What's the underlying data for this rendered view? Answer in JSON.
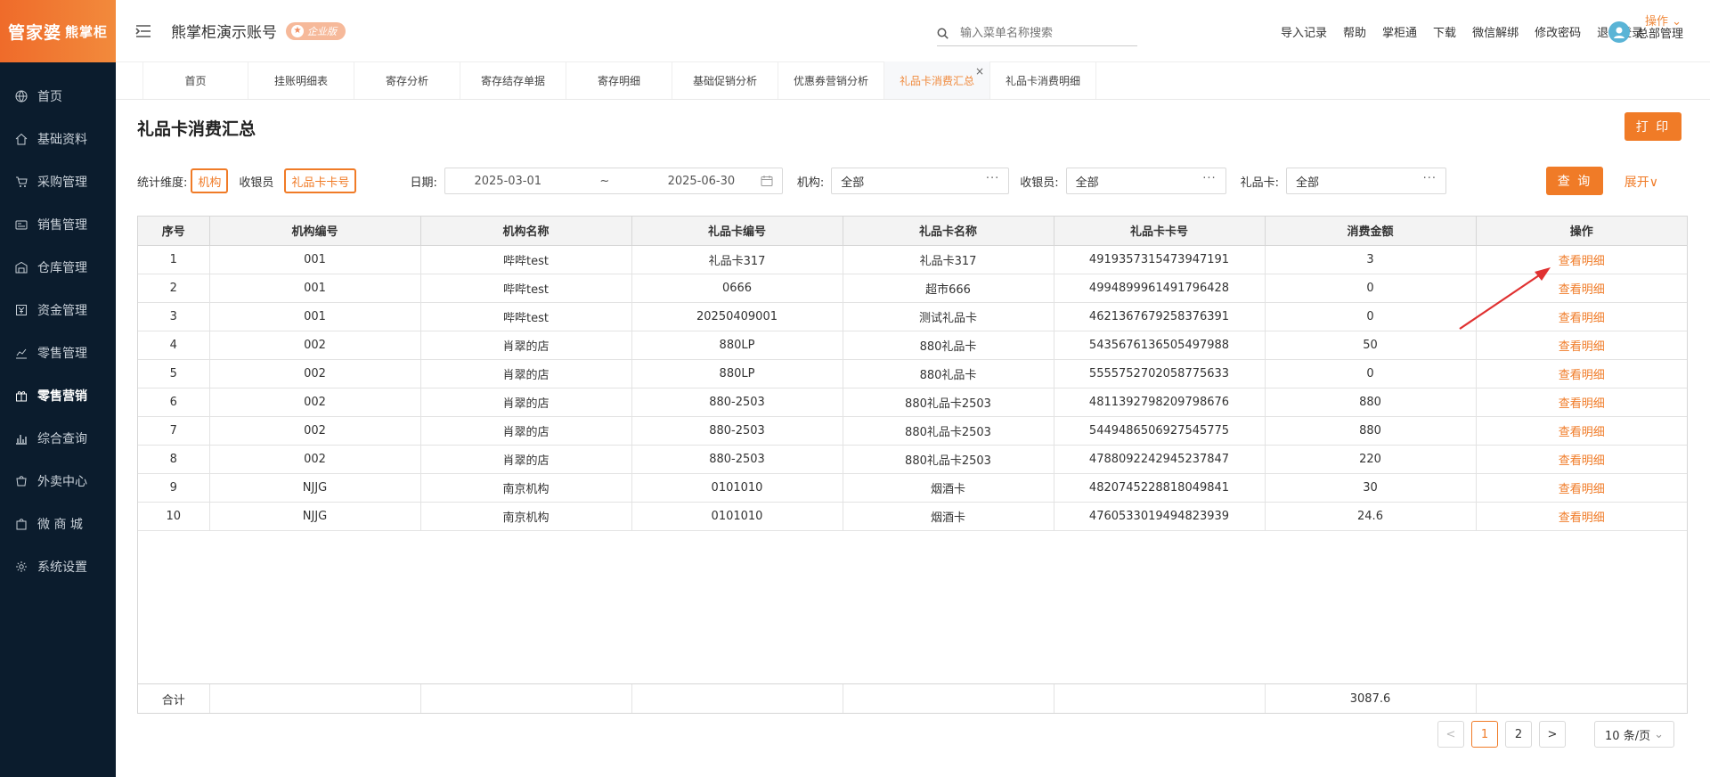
{
  "brand": {
    "main": "管家婆",
    "sub": "熊掌柜"
  },
  "sidebar": {
    "items": [
      {
        "label": "首页",
        "icon": "globe-icon"
      },
      {
        "label": "基础资料",
        "icon": "home-icon"
      },
      {
        "label": "采购管理",
        "icon": "cart-icon"
      },
      {
        "label": "销售管理",
        "icon": "register-icon"
      },
      {
        "label": "仓库管理",
        "icon": "warehouse-icon"
      },
      {
        "label": "资金管理",
        "icon": "finance-icon"
      },
      {
        "label": "零售管理",
        "icon": "chart-icon"
      },
      {
        "label": "零售营销",
        "icon": "gift-icon"
      },
      {
        "label": "综合查询",
        "icon": "bar-chart-icon"
      },
      {
        "label": "外卖中心",
        "icon": "delivery-icon"
      },
      {
        "label": "微 商 城",
        "icon": "shop-icon"
      },
      {
        "label": "系统设置",
        "icon": "gear-icon"
      }
    ]
  },
  "header": {
    "account_title": "熊掌柜演示账号",
    "edition": "企业版",
    "search_placeholder": "输入菜单名称搜索",
    "links": [
      "导入记录",
      "帮助",
      "掌柜通",
      "下载",
      "微信解绑",
      "修改密码",
      "退出登录"
    ],
    "user": "总部管理"
  },
  "tabs": [
    "首页",
    "挂账明细表",
    "寄存分析",
    "寄存结存单据",
    "寄存明细",
    "基础促销分析",
    "优惠券营销分析",
    "礼品卡消费汇总",
    "礼品卡消费明细"
  ],
  "tabs_ops": "操作",
  "page": {
    "title": "礼品卡消费汇总",
    "print": "打 印",
    "dim_label": "统计维度:",
    "dims": [
      "机构",
      "收银员",
      "礼品卡卡号"
    ],
    "date_label": "日期:",
    "date_from": "2025-03-01",
    "date_sep": "~",
    "date_to": "2025-06-30",
    "org_label": "机构:",
    "org_value": "全部",
    "cashier_label": "收银员:",
    "cashier_value": "全部",
    "card_label": "礼品卡:",
    "card_value": "全部",
    "query": "查 询",
    "expand": "展开"
  },
  "table": {
    "columns": [
      "序号",
      "机构编号",
      "机构名称",
      "礼品卡编号",
      "礼品卡名称",
      "礼品卡卡号",
      "消费金额",
      "操作"
    ],
    "rows": [
      [
        "1",
        "001",
        "哔哔test",
        "礼品卡317",
        "礼品卡317",
        "4919357315473947191",
        "3",
        "查看明细"
      ],
      [
        "2",
        "001",
        "哔哔test",
        "0666",
        "超市666",
        "4994899961491796428",
        "0",
        "查看明细"
      ],
      [
        "3",
        "001",
        "哔哔test",
        "20250409001",
        "测试礼品卡",
        "4621367679258376391",
        "0",
        "查看明细"
      ],
      [
        "4",
        "002",
        "肖翠的店",
        "880LP",
        "880礼品卡",
        "5435676136505497988",
        "50",
        "查看明细"
      ],
      [
        "5",
        "002",
        "肖翠的店",
        "880LP",
        "880礼品卡",
        "5555752702058775633",
        "0",
        "查看明细"
      ],
      [
        "6",
        "002",
        "肖翠的店",
        "880-2503",
        "880礼品卡2503",
        "4811392798209798676",
        "880",
        "查看明细"
      ],
      [
        "7",
        "002",
        "肖翠的店",
        "880-2503",
        "880礼品卡2503",
        "5449486506927545775",
        "880",
        "查看明细"
      ],
      [
        "8",
        "002",
        "肖翠的店",
        "880-2503",
        "880礼品卡2503",
        "4788092242945237847",
        "220",
        "查看明细"
      ],
      [
        "9",
        "NJJG",
        "南京机构",
        "0101010",
        "烟酒卡",
        "4820745228818049841",
        "30",
        "查看明细"
      ],
      [
        "10",
        "NJJG",
        "南京机构",
        "0101010",
        "烟酒卡",
        "4760533019494823939",
        "24.6",
        "查看明细"
      ]
    ],
    "footer_label": "合计",
    "footer_total": "3087.6"
  },
  "pager": {
    "prev": "<",
    "pages": [
      "1",
      "2"
    ],
    "current": "1",
    "next": ">",
    "page_size": "10 条/页"
  },
  "colors": {
    "accent": "#f07b27",
    "sidebar": "#0b1c2d"
  }
}
